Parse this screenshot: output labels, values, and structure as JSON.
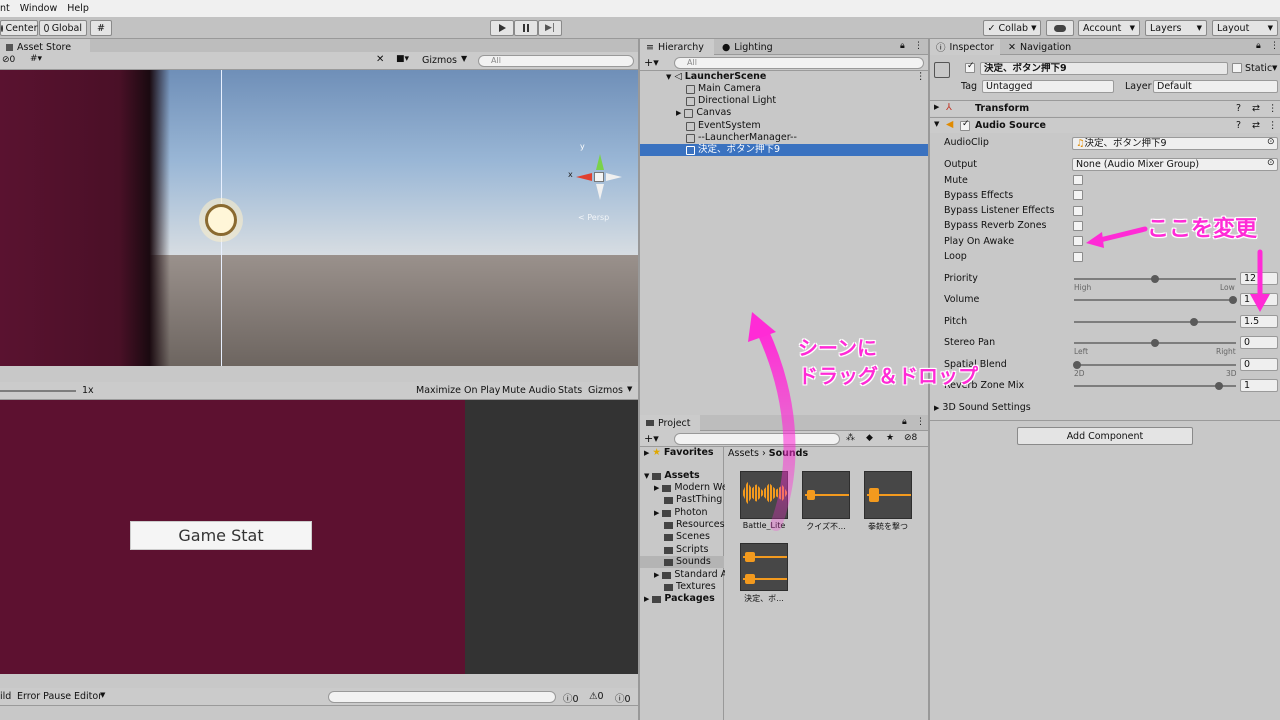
{
  "menu": [
    "nt",
    "Window",
    "Help"
  ],
  "toolbar": {
    "pivot": "Center",
    "global": "Global",
    "collab": "Collab",
    "account": "Account",
    "layers": "Layers",
    "layout": "Layout"
  },
  "scene_panel": {
    "tab": "Asset Store",
    "sub_count": "0",
    "gizmos": "Gizmos",
    "search_placeholder": "All",
    "persp": "< Persp"
  },
  "game_panel": {
    "scale": "1x",
    "maximize": "Maximize On Play",
    "mute": "Mute Audio",
    "stats": "Stats",
    "gizmos": "Gizmos",
    "button": "Game Stat"
  },
  "console_bar": {
    "build": "ild",
    "error_pause": "Error Pause",
    "editor": "Editor",
    "count_info": "0",
    "count_warn": "0",
    "count_err": "0"
  },
  "hierarchy": {
    "tab": "Hierarchy",
    "tab2": "Lighting",
    "search_placeholder": "All",
    "scene": "LauncherScene",
    "items": [
      "Main Camera",
      "Directional Light",
      "Canvas",
      "EventSystem",
      "--LauncherManager--",
      "決定、ボタン押下9"
    ]
  },
  "project": {
    "tab": "Project",
    "badge": "8",
    "favorites": "Favorites",
    "assets": "Assets",
    "folders": [
      "Modern We",
      "PastThing",
      "Photon",
      "Resources",
      "Scenes",
      "Scripts",
      "Sounds",
      "Standard A",
      "Textures"
    ],
    "packages": "Packages",
    "breadcrumb_root": "Assets",
    "breadcrumb_current": "Sounds",
    "files": [
      "Battle_Lite",
      "クイズ不...",
      "拳銃を撃つ",
      "決定、ボ..."
    ]
  },
  "inspector": {
    "tab": "Inspector",
    "tab2": "Navigation",
    "object_name": "決定、ボタン押下9",
    "static": "Static",
    "tag_label": "Tag",
    "tag_value": "Untagged",
    "layer_label": "Layer",
    "layer_value": "Default",
    "transform": "Transform",
    "audio_source": "Audio Source",
    "audioclip_label": "AudioClip",
    "audioclip_value": "決定、ボタン押下9",
    "output_label": "Output",
    "output_value": "None (Audio Mixer Group)",
    "mute": "Mute",
    "bypass_effects": "Bypass Effects",
    "bypass_listener": "Bypass Listener Effects",
    "bypass_reverb": "Bypass Reverb Zones",
    "play_on_awake": "Play On Awake",
    "loop": "Loop",
    "priority_label": "Priority",
    "priority_value": "12",
    "priority_high": "High",
    "priority_low": "Low",
    "volume_label": "Volume",
    "volume_value": "1",
    "pitch_label": "Pitch",
    "pitch_value": "1.5",
    "stereo_label": "Stereo Pan",
    "stereo_value": "0",
    "stereo_left": "Left",
    "stereo_right": "Right",
    "spatial_label": "Spatial Blend",
    "spatial_value": "0",
    "spatial_2d": "2D",
    "spatial_3d": "3D",
    "reverb_label": "Reverb Zone Mix",
    "reverb_value": "1",
    "sound3d": "3D Sound Settings",
    "add_component": "Add Component"
  },
  "annotations": {
    "change_here": "ここを変更",
    "drag_line1": "シーンに",
    "drag_line2": "ドラッグ＆ドロップ"
  },
  "colors": {
    "game_bg": "#5d1130",
    "highlight": "#3a72c0",
    "annotation": "#ff2bd6"
  }
}
